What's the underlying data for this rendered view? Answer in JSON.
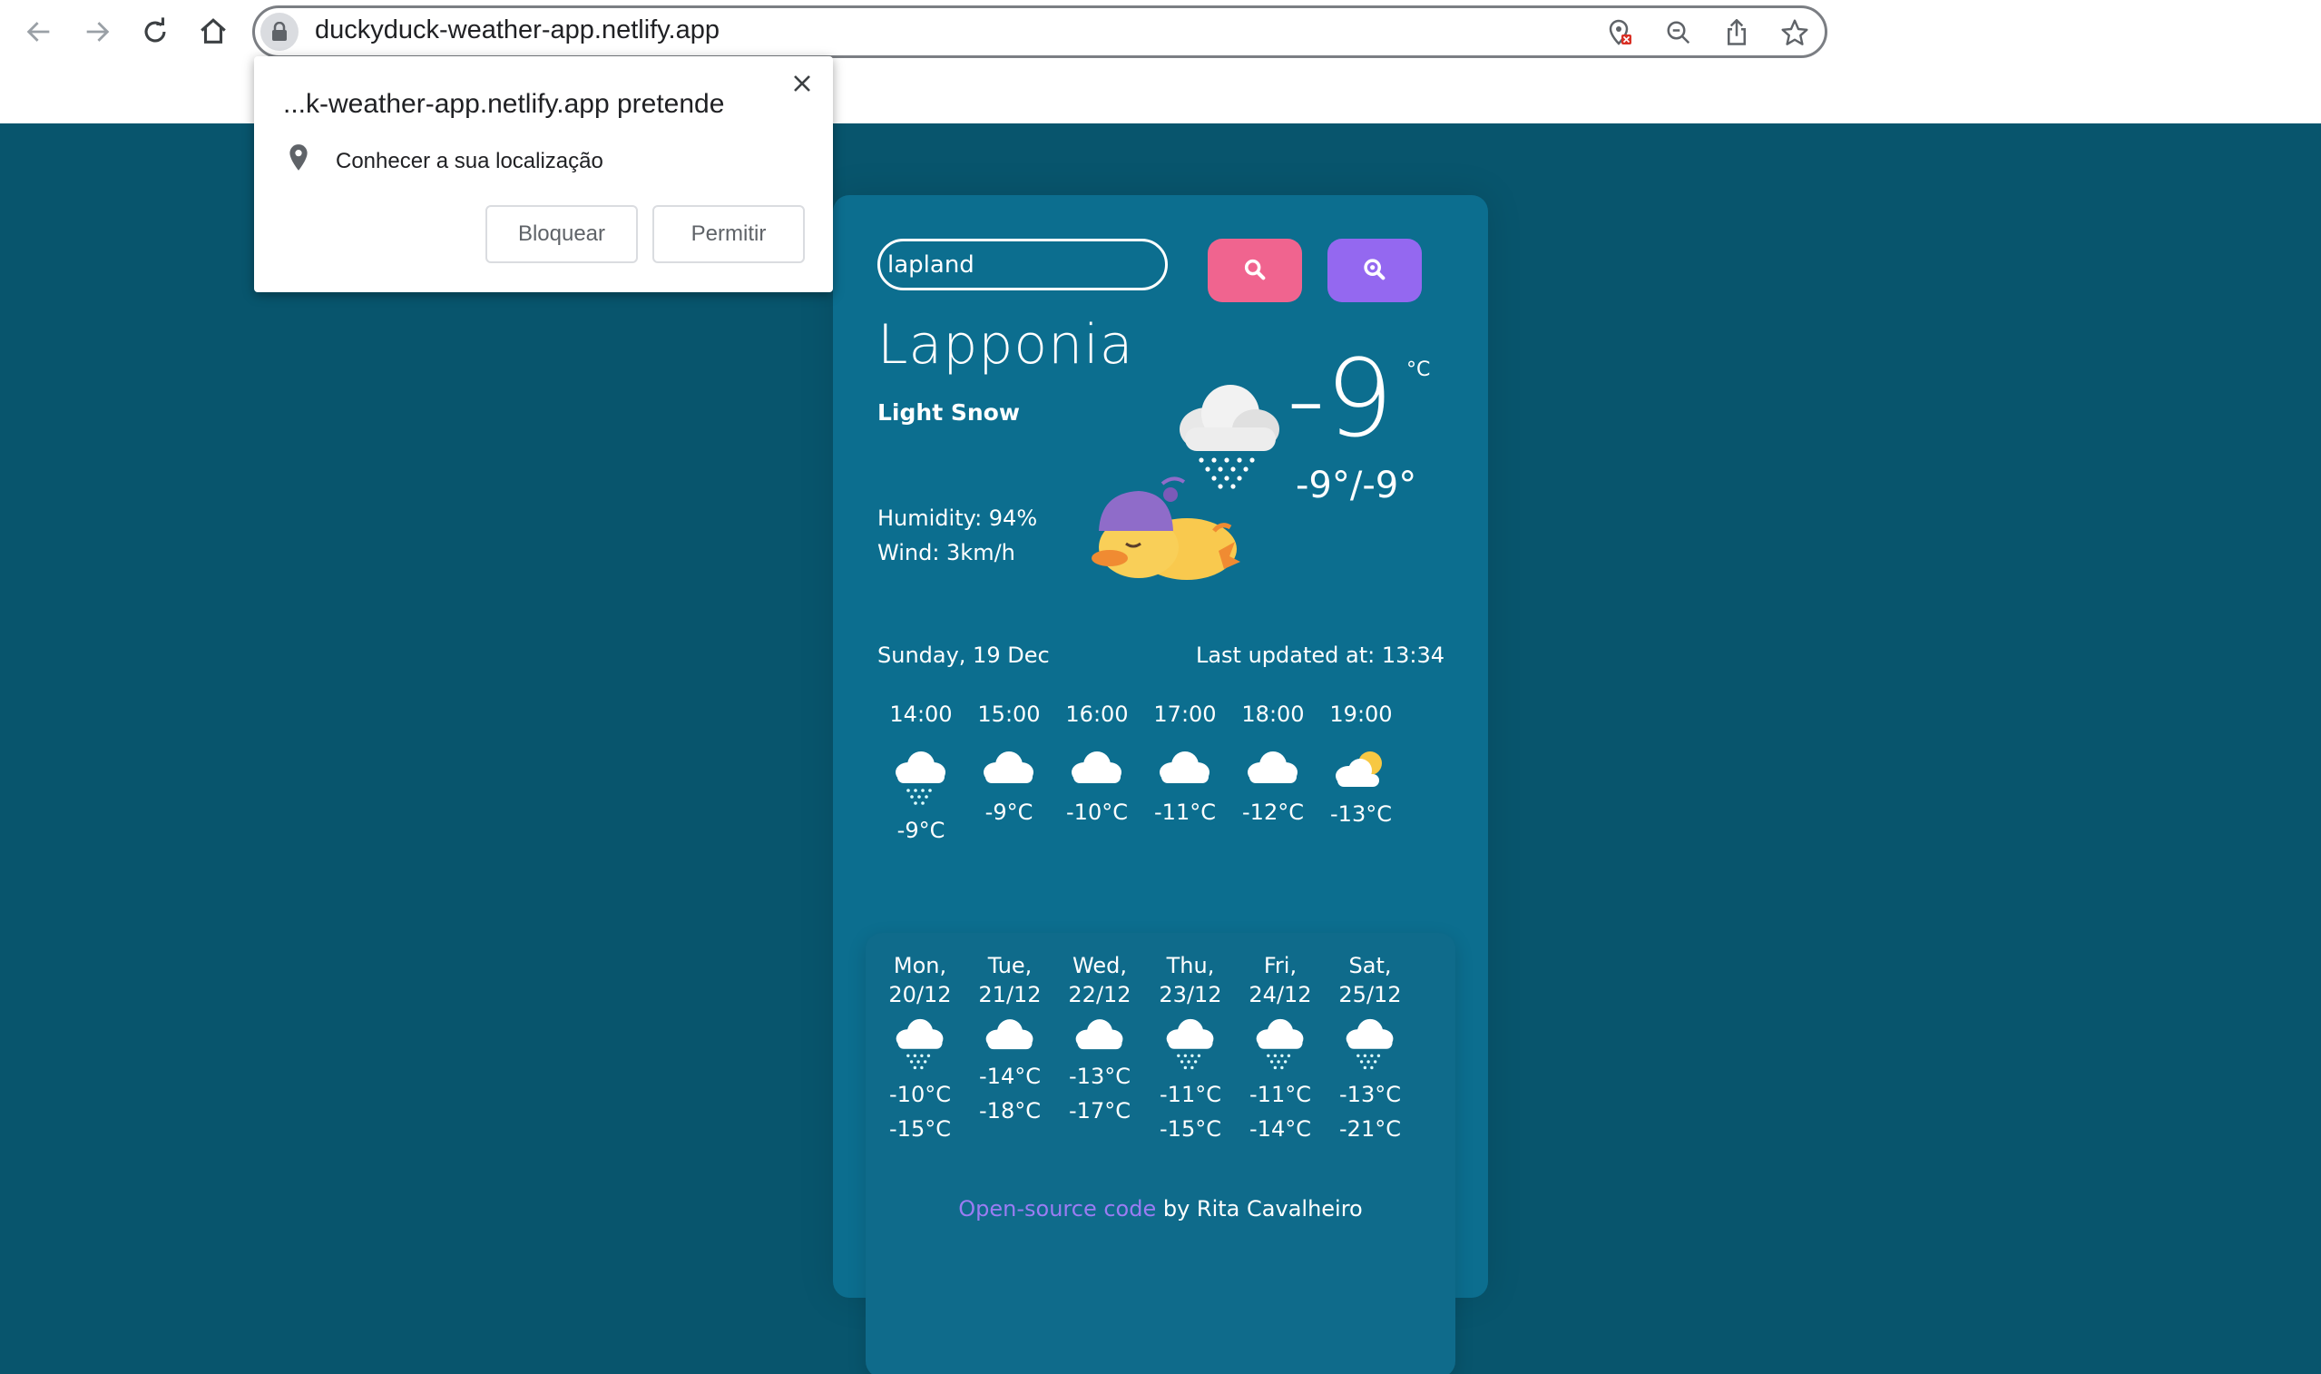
{
  "browser": {
    "url": "duckyduck-weather-app.netlify.app"
  },
  "permission_popup": {
    "title": "...k-weather-app.netlify.app pretende",
    "permission_text": "Conhecer a sua localização",
    "block_label": "Bloquear",
    "allow_label": "Permitir"
  },
  "search": {
    "value": "lapland"
  },
  "current": {
    "city": "Lapponia",
    "description": "Light Snow",
    "temperature": "-9",
    "unit": "°C",
    "min_max": "-9°/-9°",
    "humidity": "Humidity: 94%",
    "wind": "Wind: 3km/h",
    "date": "Sunday, 19 Dec",
    "last_updated": "Last updated at: 13:34"
  },
  "hourly": [
    {
      "time": "14:00",
      "temp": "-9°C",
      "icon": "snow-cloud"
    },
    {
      "time": "15:00",
      "temp": "-9°C",
      "icon": "cloud"
    },
    {
      "time": "16:00",
      "temp": "-10°C",
      "icon": "cloud"
    },
    {
      "time": "17:00",
      "temp": "-11°C",
      "icon": "cloud"
    },
    {
      "time": "18:00",
      "temp": "-12°C",
      "icon": "cloud"
    },
    {
      "time": "19:00",
      "temp": "-13°C",
      "icon": "partly-cloudy"
    }
  ],
  "daily": [
    {
      "day": "Mon,",
      "date": "20/12",
      "max": "-10°C",
      "min": "-15°C",
      "icon": "snow-cloud"
    },
    {
      "day": "Tue,",
      "date": "21/12",
      "max": "-14°C",
      "min": "-18°C",
      "icon": "cloud"
    },
    {
      "day": "Wed,",
      "date": "22/12",
      "max": "-13°C",
      "min": "-17°C",
      "icon": "cloud"
    },
    {
      "day": "Thu,",
      "date": "23/12",
      "max": "-11°C",
      "min": "-15°C",
      "icon": "snow-cloud"
    },
    {
      "day": "Fri,",
      "date": "24/12",
      "max": "-11°C",
      "min": "-14°C",
      "icon": "snow-cloud"
    },
    {
      "day": "Sat,",
      "date": "25/12",
      "max": "-13°C",
      "min": "-21°C",
      "icon": "snow-cloud"
    }
  ],
  "footer": {
    "link_text": "Open-source code",
    "author_text": " by Rita Cavalheiro"
  },
  "colors": {
    "background": "#08556d",
    "card": "#0c6e8f",
    "search_button": "#f0648f",
    "location_button": "#9468f0",
    "link": "#9b7cf3"
  }
}
